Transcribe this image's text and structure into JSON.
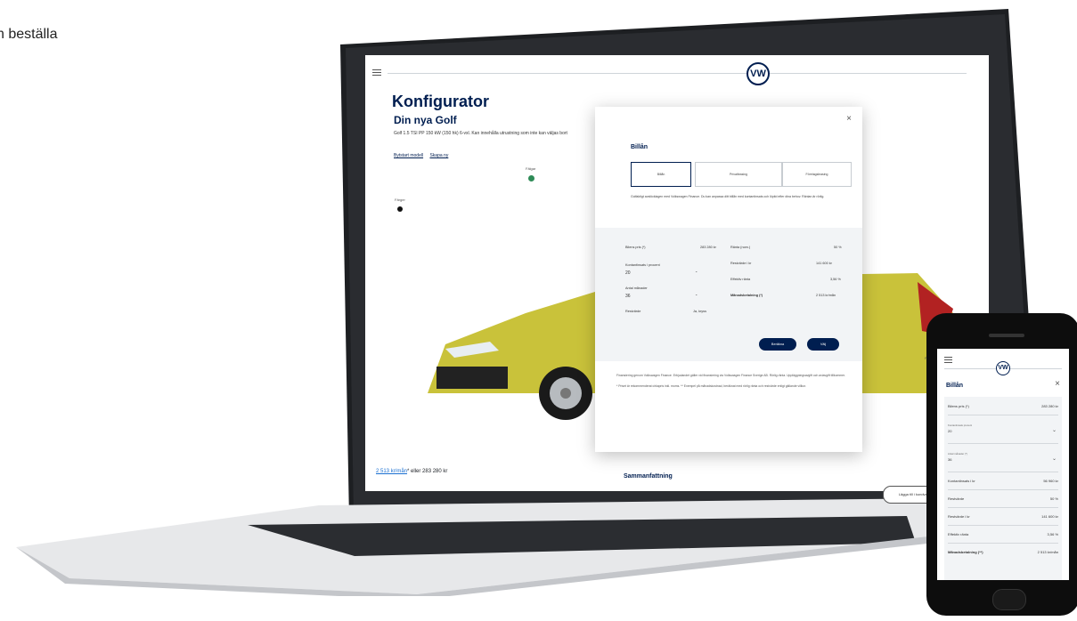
{
  "caption": "n beställa",
  "laptop": {
    "page_title": "Konfigurator",
    "model_title": "Din nya Golf",
    "model_desc": "Golf 1.5 TSI PP 150 kW (150 hk) 6-vxl. Kan innehålla utrustning som inte kan väljas bort",
    "links": [
      "Bytstart modell",
      "Skapa ny"
    ],
    "color_labels": [
      "Färger",
      "Fälgar"
    ],
    "price_link": "2 513 kr/mån",
    "price_rest": "* eller 283 280 kr",
    "summary": "Sammanfattning",
    "right_button": "Lägga till i kundvagn",
    "nav_label": "Fälgar"
  },
  "modal": {
    "close": "×",
    "heading": "Billån",
    "tabs": [
      "Billån",
      "Privatleasing",
      "Företagsleasing"
    ],
    "intro": "Golfaktigt avstöcklagen med Volkswagen Finance. Du kan anpassa ditt billån med kontantinsats och löptid efter dina behov. Räntan är rörlig.",
    "rows_left": [
      {
        "label": "Bilens pris (*)",
        "value": "283 280 kr"
      },
      {
        "label": "Kontantinsats i procent",
        "value": "20"
      },
      {
        "label": "Antal månader",
        "value": "36"
      },
      {
        "label": "Restvärde",
        "value": "Ja, kryss"
      }
    ],
    "rows_right": [
      {
        "label": "Ränta (nom.)",
        "value": "50 %"
      },
      {
        "label": "Restvärde i kr",
        "value": "141 600 kr"
      },
      {
        "label": "Effektiv ränta",
        "value": "3,56 %"
      },
      {
        "label": "Månadsbetalning (*)",
        "value": "2 513 kr/mån"
      }
    ],
    "buttons": [
      "Beräkna",
      "Välj"
    ],
    "footer_1": "Finansiering genom Volkswagen Finance. Erbjudandet gäller vid finansiering via Volkswagen Finance Sverige AB. Rörlig ränta. Uppläggningsavgift och aviavgift tillkommer.",
    "footer_2": "* Priset är rekommenderat cirkapris inkl. moms. ** Exempel på månadskostnad, beräknat med rörlig ränta och restvärde enligt gällande villkor."
  },
  "phone": {
    "title": "Billån",
    "close": "×",
    "rows": [
      {
        "label": "Bilens pris (*)",
        "value": "283 280 kr"
      },
      {
        "label": "Kontantinsats",
        "value": "",
        "sub": "Kontantinsats procent",
        "input": "20"
      },
      {
        "label": "Antal månader",
        "value": "",
        "sub": "Antal månader (*)",
        "input": "36"
      },
      {
        "label": "Kontantinsats i kr",
        "value": "56 960 kr"
      },
      {
        "label": "Restvärde",
        "value": "50 %"
      },
      {
        "label": "Restvärde i kr",
        "value": "141 600 kr"
      },
      {
        "label": "Effektiv ränta",
        "value": "3,56 %"
      },
      {
        "label": "Månadsbetalning (**)",
        "value": "2 513 kr/mån"
      }
    ]
  },
  "colors": {
    "vw_blue": "#001e50",
    "car_yellow": "#c9c23a",
    "swatch_green": "#2e8b57",
    "link_blue": "#1a6fd1"
  }
}
